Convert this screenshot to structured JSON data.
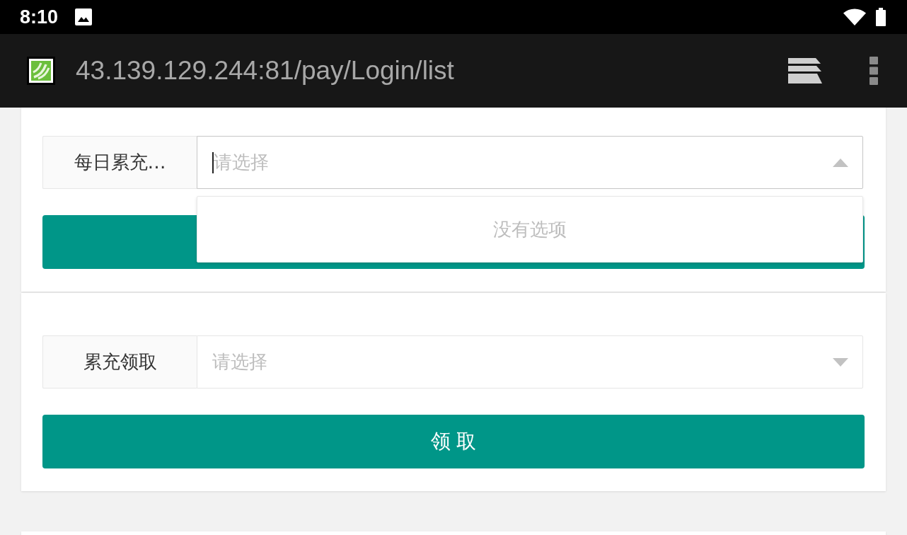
{
  "status_bar": {
    "time": "8:10"
  },
  "browser": {
    "url": "43.139.129.244:81/pay/Login/list"
  },
  "forms": [
    {
      "label": "每日累充…",
      "select": {
        "placeholder": "请选择",
        "expanded": true,
        "empty_text": "没有选项"
      }
    },
    {
      "label": "累充领取",
      "select": {
        "placeholder": "请选择",
        "expanded": false
      },
      "button": "领 取"
    }
  ]
}
